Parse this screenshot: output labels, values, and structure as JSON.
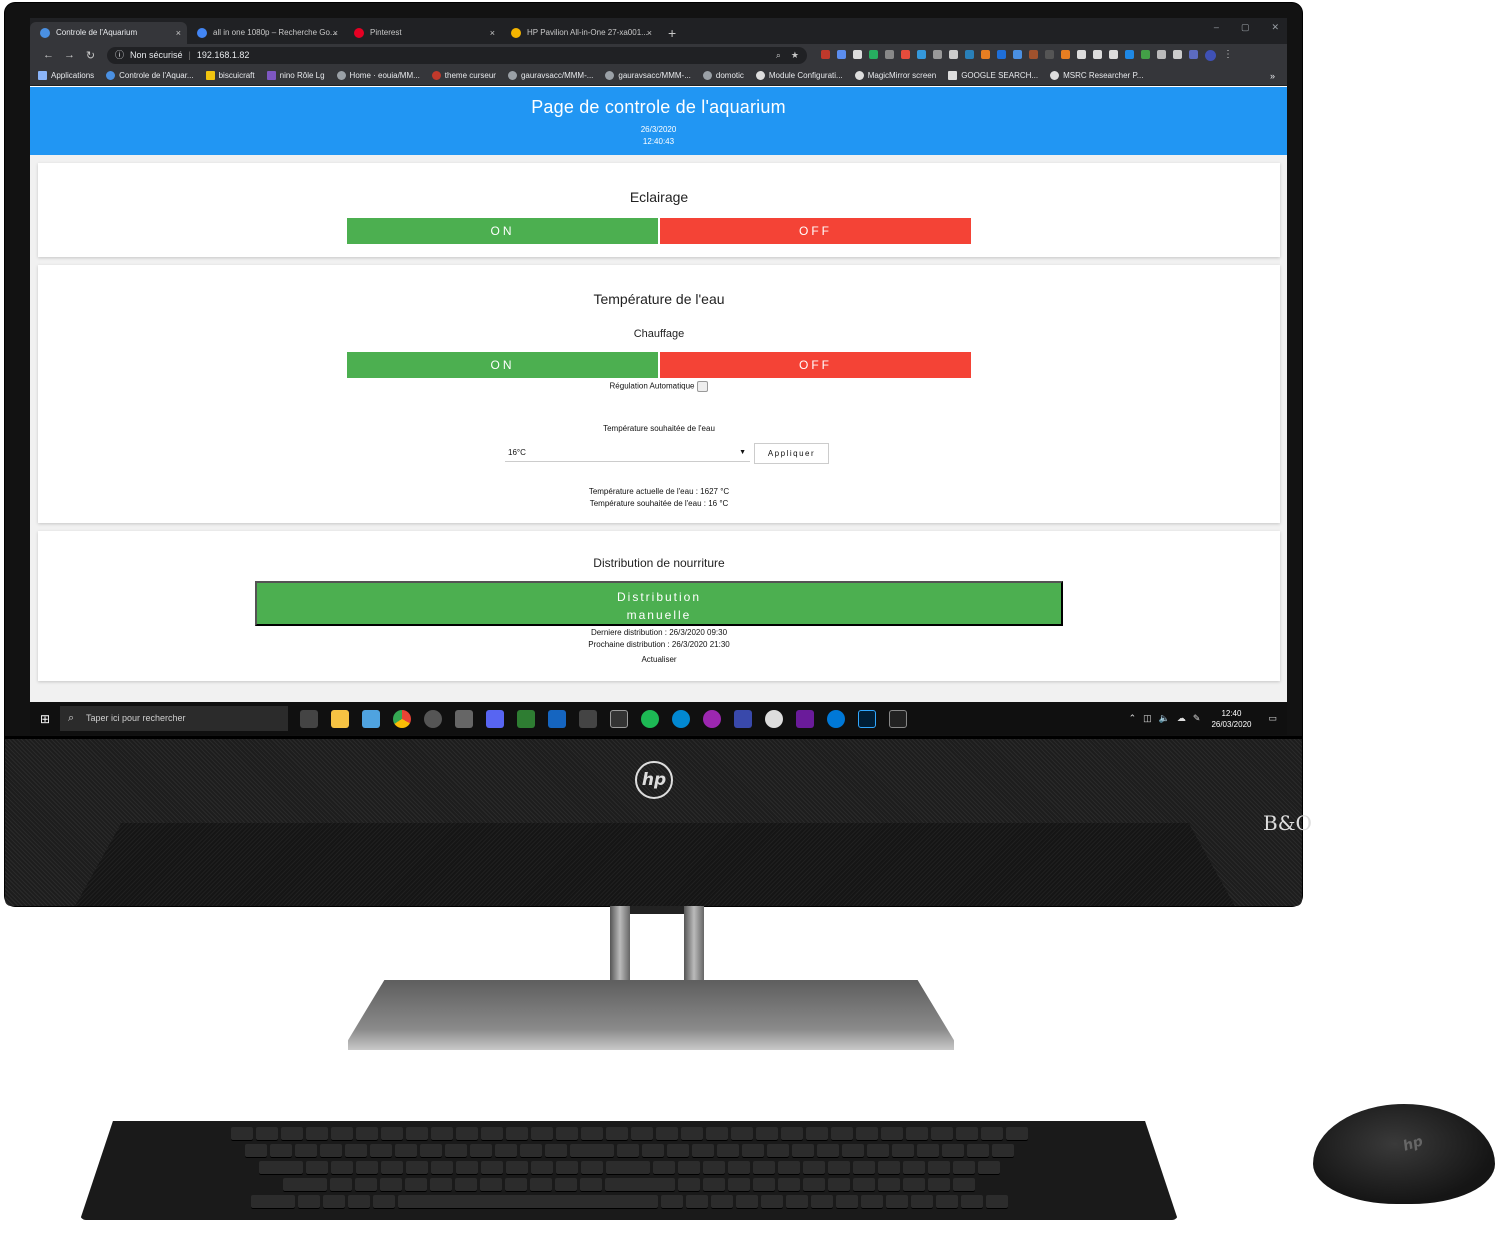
{
  "browser": {
    "tabs": [
      {
        "label": "Controle de l'Aquarium",
        "close": "×",
        "favicon_color": "#4a90e2"
      },
      {
        "label": "all in one 1080p – Recherche Go...",
        "close": "×",
        "favicon_color": "#4285f4"
      },
      {
        "label": "Pinterest",
        "close": "×",
        "favicon_color": "#e60023"
      },
      {
        "label": "HP Pavilion All-in-One 27-xa001...",
        "close": "×",
        "favicon_color": "#f4b400"
      }
    ],
    "new_tab": "+",
    "window_controls": {
      "minimize": "–",
      "maximize": "▢",
      "close": "✕"
    },
    "security_label": "Non sécurisé",
    "url": "192.168.1.82",
    "bookmarks": [
      "Applications",
      "Controle de l'Aquar...",
      "biscuicraft",
      "nino Rôle Lg",
      "Home · eouia/MM...",
      "theme curseur",
      "gauravsacc/MMM-...",
      "gauravsacc/MMM-...",
      "domotic",
      "Module Configurati...",
      "MagicMirror screen",
      "GOOGLE SEARCH...",
      "MSRC Researcher P..."
    ],
    "bookmarks_more": "»"
  },
  "page": {
    "title": "Page de controle de l'aquarium",
    "date": "26/3/2020",
    "time": "12:40:43",
    "lighting": {
      "title": "Eclairage",
      "on_label": "ON",
      "off_label": "OFF"
    },
    "temperature": {
      "title": "Température de l'eau",
      "heating_label": "Chauffage",
      "on_label": "ON",
      "off_label": "OFF",
      "auto_regulation_label": "Régulation Automatique",
      "target_label": "Température souhaitée de l'eau",
      "select_value": "16°C",
      "select_arrow": "▼",
      "apply_label": "Appliquer",
      "current_text": "Température actuelle de l'eau : 1627 °C",
      "target_text": "Température souhaitée de l'eau : 16 °C"
    },
    "food": {
      "title": "Distribution de nourriture",
      "button_line1": "Distribution",
      "button_line2": "manuelle",
      "last_text": "Derniere distribution : 26/3/2020 09:30",
      "next_text": "Prochaine distribution : 26/3/2020 21:30",
      "refresh_label": "Actualiser"
    },
    "colors": {
      "header": "#2196f3",
      "on": "#4caf50",
      "off": "#f44336"
    }
  },
  "taskbar": {
    "search_placeholder": "Taper ici pour rechercher",
    "clock_time": "12:40",
    "clock_date": "26/03/2020"
  }
}
